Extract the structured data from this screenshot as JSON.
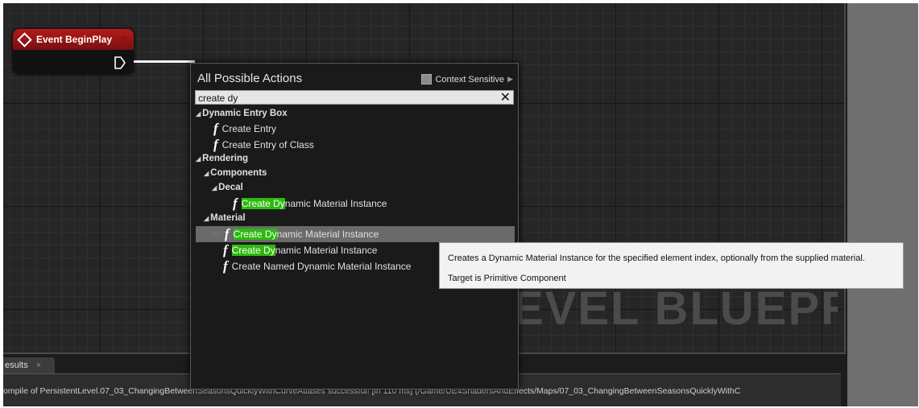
{
  "graph": {
    "watermark": "EVEL BLUEPRINT"
  },
  "node": {
    "title": "Event BeginPlay"
  },
  "actions_menu": {
    "title": "All Possible Actions",
    "context_sensitive_label": "Context Sensitive",
    "search": {
      "value": "create dy",
      "placeholder": ""
    },
    "tree": [
      {
        "kind": "category",
        "label": "Dynamic Entry Box"
      },
      {
        "kind": "function",
        "label": "Create Entry"
      },
      {
        "kind": "function",
        "label": "Create Entry of Class"
      },
      {
        "kind": "category",
        "label": "Rendering"
      },
      {
        "kind": "category",
        "label": "Components"
      },
      {
        "kind": "category",
        "label": "Decal"
      },
      {
        "kind": "function",
        "match": "Create Dy",
        "rest": "namic Material Instance"
      },
      {
        "kind": "category",
        "label": "Material"
      },
      {
        "kind": "function",
        "match": "Create Dy",
        "rest": "namic Material Instance"
      },
      {
        "kind": "function",
        "match": "Create Dy",
        "rest": "namic Material Instance"
      },
      {
        "kind": "function",
        "label": "Create Named Dynamic Material Instance"
      }
    ]
  },
  "tooltip": {
    "description": "Creates a Dynamic Material Instance for the specified element index, optionally from the supplied material.",
    "target": "Target is Primitive Component"
  },
  "results": {
    "tab_label": "esults",
    "close_glyph": "×",
    "log_left": "ompile of PersistentLevel.07_03_ChangingBetweenSeasonsQuicklyWithCurveAtlases successful! [in 110 ms] (/Game/UE4ShadersAndEffects/Maps/07_03_ChangingBetweenSeasonsQuicklyWithC"
  },
  "colors": {
    "highlight": "#2db90f",
    "node_header": "#b31a1a",
    "graph_bg": "#262626"
  },
  "icons": {
    "function": "function-icon",
    "event": "event-diamond-icon",
    "exec_pin": "exec-pin-icon"
  }
}
